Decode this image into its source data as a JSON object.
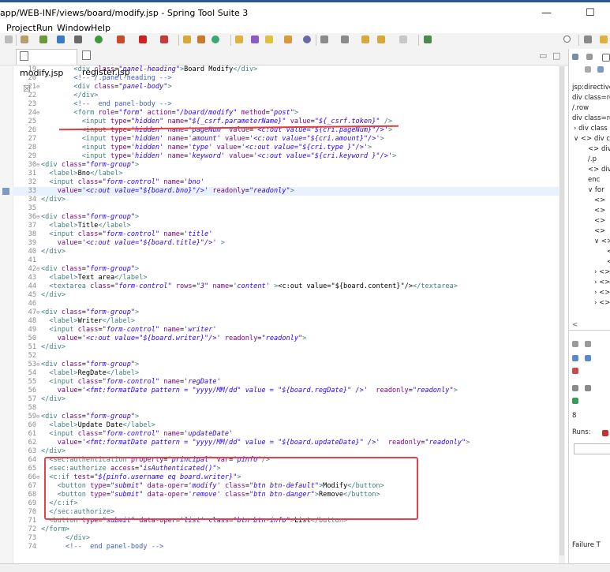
{
  "window": {
    "title": "app/WEB-INF/views/board/modify.jsp - Spring Tool Suite 3"
  },
  "menu": [
    "Project",
    "Run",
    "Window",
    "Help"
  ],
  "tabs": [
    {
      "label": "modify.jsp",
      "close": "☒",
      "active": true
    },
    {
      "label": "register.jsp",
      "active": false
    }
  ],
  "lines": [
    {
      "n": "19",
      "fold": "",
      "html": "        <span class=\"tag\">&lt;div</span> <span class=\"an\">class</span>=<span class=\"av\">\"panel-heading\"</span><span class=\"tag\">&gt;</span>Board Modify<span class=\"tag\">&lt;/div&gt;</span>"
    },
    {
      "n": "20",
      "fold": "",
      "html": "        <span class=\"cm\">&lt;!-- /.panel-heading --&gt;</span>"
    },
    {
      "n": "21",
      "fold": "⊖",
      "html": "        <span class=\"tag\">&lt;div</span> <span class=\"an\">class</span>=<span class=\"av\">\"panel-body\"</span><span class=\"tag\">&gt;</span>"
    },
    {
      "n": "22",
      "fold": "",
      "html": "        <span class=\"tag\">&lt;/div&gt;</span>"
    },
    {
      "n": "23",
      "fold": "",
      "html": "        <span class=\"cm\">&lt;!--  end panel-body --&gt;</span>"
    },
    {
      "n": "24",
      "fold": "⊖",
      "html": "        <span class=\"tag\">&lt;form</span> <span class=\"an\">role</span>=<span class=\"av\">\"form\"</span> <span class=\"an\">action</span>=<span class=\"av\">\"/board/modify\"</span> <span class=\"an\">method</span>=<span class=\"av\">\"post\"</span><span class=\"tag\">&gt;</span>"
    },
    {
      "n": "25",
      "fold": "",
      "html": "          <span class=\"tag\">&lt;input</span> <span class=\"an\">type</span>=<span class=\"av\">\"hidden\"</span> <span class=\"an\">name</span>=<span class=\"av\">\"${_csrf.parameterName}\"</span> <span class=\"an\">value</span>=<span class=\"av\">\"${_csrf.token}\"</span> <span class=\"tag\">/&gt;</span>"
    },
    {
      "n": "26",
      "fold": "",
      "html": "          <span class=\"tag\">&lt;input</span> <span class=\"an\">type</span>=<span class=\"av\">'hidden'</span> <span class=\"an\">name</span>=<span class=\"av\">'pageNum'</span> <span class=\"an\">value</span>=<span class=\"av\">'&lt;c:out value=\"${cri.pageNum}\"/&gt;'</span><span class=\"tag\">&gt;</span>"
    },
    {
      "n": "27",
      "fold": "",
      "html": "          <span class=\"tag\">&lt;input</span> <span class=\"an\">type</span>=<span class=\"av\">'hidden'</span> <span class=\"an\">name</span>=<span class=\"av\">'amount'</span> <span class=\"an\">value</span>=<span class=\"av\">'&lt;c:out value=\"${cri.amount}\"/&gt;'</span><span class=\"tag\">&gt;</span>"
    },
    {
      "n": "28",
      "fold": "",
      "html": "          <span class=\"tag\">&lt;input</span> <span class=\"an\">type</span>=<span class=\"av\">'hidden'</span> <span class=\"an\">name</span>=<span class=\"av\">'type'</span> <span class=\"an\">value</span>=<span class=\"av\">'&lt;c:out value=\"${cri.type }\"/&gt;'</span><span class=\"tag\">&gt;</span>"
    },
    {
      "n": "29",
      "fold": "",
      "html": "          <span class=\"tag\">&lt;input</span> <span class=\"an\">type</span>=<span class=\"av\">'hidden'</span> <span class=\"an\">name</span>=<span class=\"av\">'keyword'</span> <span class=\"an\">value</span>=<span class=\"av\">'&lt;c:out value=\"${cri.keyword }\"/&gt;'</span><span class=\"tag\">&gt;</span>"
    },
    {
      "n": "30",
      "fold": "⊖",
      "html": "<span class=\"tag\">&lt;div</span> <span class=\"an\">class</span>=<span class=\"av\">\"form-group\"</span><span class=\"tag\">&gt;</span>"
    },
    {
      "n": "31",
      "fold": "",
      "html": "  <span class=\"tag\">&lt;label&gt;</span>Bno<span class=\"tag\">&lt;/label&gt;</span>"
    },
    {
      "n": "32",
      "fold": "",
      "html": "  <span class=\"tag\">&lt;input</span> <span class=\"an\">class</span>=<span class=\"av\">\"form-control\"</span> <span class=\"an\">name</span>=<span class=\"av\">'bno'</span>"
    },
    {
      "n": "33",
      "fold": "",
      "cur": true,
      "html": "    <span class=\"an\">value</span>=<span class=\"av\">'&lt;c:out value=\"${board.bno}\"/&gt;'</span> <span class=\"an\">readonly</span>=<span class=\"av\">\"readonly\"</span><span class=\"tag\">&gt;</span>"
    },
    {
      "n": "34",
      "fold": "",
      "html": "<span class=\"tag\">&lt;/div&gt;</span>"
    },
    {
      "n": "35",
      "fold": "",
      "html": ""
    },
    {
      "n": "36",
      "fold": "⊖",
      "html": "<span class=\"tag\">&lt;div</span> <span class=\"an\">class</span>=<span class=\"av\">\"form-group\"</span><span class=\"tag\">&gt;</span>"
    },
    {
      "n": "37",
      "fold": "",
      "html": "  <span class=\"tag\">&lt;label&gt;</span>Title<span class=\"tag\">&lt;/label&gt;</span>"
    },
    {
      "n": "38",
      "fold": "",
      "html": "  <span class=\"tag\">&lt;input</span> <span class=\"an\">class</span>=<span class=\"av\">\"form-control\"</span> <span class=\"an\">name</span>=<span class=\"av\">'title'</span>"
    },
    {
      "n": "39",
      "fold": "",
      "html": "    <span class=\"an\">value</span>=<span class=\"av\">'&lt;c:out value=\"${board.title}\"/&gt;'</span> <span class=\"tag\">&gt;</span>"
    },
    {
      "n": "40",
      "fold": "",
      "html": "<span class=\"tag\">&lt;/div&gt;</span>"
    },
    {
      "n": "41",
      "fold": "",
      "html": ""
    },
    {
      "n": "42",
      "fold": "⊖",
      "html": "<span class=\"tag\">&lt;div</span> <span class=\"an\">class</span>=<span class=\"av\">\"form-group\"</span><span class=\"tag\">&gt;</span>"
    },
    {
      "n": "43",
      "fold": "",
      "html": "  <span class=\"tag\">&lt;label&gt;</span>Text area<span class=\"tag\">&lt;/label&gt;</span>"
    },
    {
      "n": "44",
      "fold": "",
      "html": "  <span class=\"tag\">&lt;textarea</span> <span class=\"an\">class</span>=<span class=\"av\">\"form-control\"</span> <span class=\"an\">rows</span>=<span class=\"av\">\"3\"</span> <span class=\"an\">name</span>=<span class=\"av\">'content'</span> <span class=\"tag\">&gt;</span>&lt;c:out value=\"${board.content}\"/&gt;<span class=\"tag\">&lt;/textarea&gt;</span>"
    },
    {
      "n": "45",
      "fold": "",
      "html": "<span class=\"tag\">&lt;/div&gt;</span>"
    },
    {
      "n": "46",
      "fold": "",
      "html": ""
    },
    {
      "n": "47",
      "fold": "⊖",
      "html": "<span class=\"tag\">&lt;div</span> <span class=\"an\">class</span>=<span class=\"av\">\"form-group\"</span><span class=\"tag\">&gt;</span>"
    },
    {
      "n": "48",
      "fold": "",
      "html": "  <span class=\"tag\">&lt;label&gt;</span>Writer<span class=\"tag\">&lt;/label&gt;</span>"
    },
    {
      "n": "49",
      "fold": "",
      "html": "  <span class=\"tag\">&lt;input</span> <span class=\"an\">class</span>=<span class=\"av\">\"form-control\"</span> <span class=\"an\">name</span>=<span class=\"av\">'writer'</span>"
    },
    {
      "n": "50",
      "fold": "",
      "html": "    <span class=\"an\">value</span>=<span class=\"av\">'&lt;c:out value=\"${board.writer}\"/&gt;'</span> <span class=\"an\">readonly</span>=<span class=\"av\">\"readonly\"</span><span class=\"tag\">&gt;</span>"
    },
    {
      "n": "51",
      "fold": "",
      "html": "<span class=\"tag\">&lt;/div&gt;</span>"
    },
    {
      "n": "52",
      "fold": "",
      "html": ""
    },
    {
      "n": "53",
      "fold": "⊖",
      "html": "<span class=\"tag\">&lt;div</span> <span class=\"an\">class</span>=<span class=\"av\">\"form-group\"</span><span class=\"tag\">&gt;</span>"
    },
    {
      "n": "54",
      "fold": "",
      "html": "  <span class=\"tag\">&lt;label&gt;</span>RegDate<span class=\"tag\">&lt;/label&gt;</span>"
    },
    {
      "n": "55",
      "fold": "",
      "html": "  <span class=\"tag\">&lt;input</span> <span class=\"an\">class</span>=<span class=\"av\">\"form-control\"</span> <span class=\"an\">name</span>=<span class=\"av\">'regDate'</span>"
    },
    {
      "n": "56",
      "fold": "",
      "html": "    <span class=\"an\">value</span>=<span class=\"av\">'&lt;fmt:formatDate pattern = \"yyyy/MM/dd\" value = \"${board.regDate}\" /&gt;'</span>  <span class=\"an\">readonly</span>=<span class=\"av\">\"readonly\"</span><span class=\"tag\">&gt;</span>"
    },
    {
      "n": "57",
      "fold": "",
      "html": "<span class=\"tag\">&lt;/div&gt;</span>"
    },
    {
      "n": "58",
      "fold": "",
      "html": ""
    },
    {
      "n": "59",
      "fold": "⊖",
      "html": "<span class=\"tag\">&lt;div</span> <span class=\"an\">class</span>=<span class=\"av\">\"form-group\"</span><span class=\"tag\">&gt;</span>"
    },
    {
      "n": "60",
      "fold": "",
      "html": "  <span class=\"tag\">&lt;label&gt;</span>Update Date<span class=\"tag\">&lt;/label&gt;</span>"
    },
    {
      "n": "61",
      "fold": "",
      "html": "  <span class=\"tag\">&lt;input</span> <span class=\"an\">class</span>=<span class=\"av\">\"form-control\"</span> <span class=\"an\">name</span>=<span class=\"av\">'updateDate'</span>"
    },
    {
      "n": "62",
      "fold": "",
      "html": "    <span class=\"an\">value</span>=<span class=\"av\">'&lt;fmt:formatDate pattern = \"yyyy/MM/dd\" value = \"${board.updateDate}\" /&gt;'</span>  <span class=\"an\">readonly</span>=<span class=\"av\">\"readonly\"</span><span class=\"tag\">&gt;</span>"
    },
    {
      "n": "63",
      "fold": "",
      "html": "<span class=\"tag\">&lt;/div&gt;</span>"
    },
    {
      "n": "64",
      "fold": "",
      "html": "  <span class=\"tag\">&lt;sec:authentication</span> <span class=\"an\">property</span>=<span class=\"av\">\"principal\"</span> <span class=\"an\">var</span>=<span class=\"av\">\"pinfo\"</span><span class=\"tag\">/&gt;</span>"
    },
    {
      "n": "65",
      "fold": "",
      "html": "  <span class=\"tag\">&lt;sec:authorize</span> <span class=\"an\">access</span>=<span class=\"av\">\"isAuthenticated()\"</span><span class=\"tag\">&gt;</span>"
    },
    {
      "n": "66",
      "fold": "⊖",
      "html": "  <span class=\"tag\">&lt;c:if</span> <span class=\"an\">test</span>=<span class=\"av\">\"${pinfo.username eq board.writer}\"</span><span class=\"tag\">&gt;</span>"
    },
    {
      "n": "67",
      "fold": "",
      "html": "    <span class=\"tag\">&lt;button</span> <span class=\"an\">type</span>=<span class=\"av\">\"submit\"</span> <span class=\"an\">data-oper</span>=<span class=\"av\">'modify'</span> <span class=\"an\">class</span>=<span class=\"av\">\"btn btn-default\"</span><span class=\"tag\">&gt;</span>Modify<span class=\"tag\">&lt;/button&gt;</span>"
    },
    {
      "n": "68",
      "fold": "",
      "html": "    <span class=\"tag\">&lt;button</span> <span class=\"an\">type</span>=<span class=\"av\">\"submit\"</span> <span class=\"an\">data-oper</span>=<span class=\"av\">'remove'</span> <span class=\"an\">class</span>=<span class=\"av\">\"btn btn-danger\"</span><span class=\"tag\">&gt;</span>Remove<span class=\"tag\">&lt;/button&gt;</span>"
    },
    {
      "n": "69",
      "fold": "",
      "html": "  <span class=\"tag\">&lt;/c:if&gt;</span>"
    },
    {
      "n": "70",
      "fold": "",
      "html": "  <span class=\"tag\">&lt;/sec:authorize&gt;</span>"
    },
    {
      "n": "71",
      "fold": "",
      "html": "  <span class=\"tag\">&lt;button</span> <span class=\"an\">type</span>=<span class=\"av\">\"submit\"</span> <span class=\"an\">data-oper</span>=<span class=\"av\">'list'</span> <span class=\"an\">class</span>=<span class=\"av\">\"btn btn-info\"</span><span class=\"tag\">&gt;</span>List<span class=\"tag\">&lt;/button&gt;</span>"
    },
    {
      "n": "72",
      "fold": "",
      "html": "<span class=\"tag\">&lt;/form&gt;</span>"
    },
    {
      "n": "73",
      "fold": "",
      "html": "      <span class=\"tag\">&lt;/div&gt;</span>"
    },
    {
      "n": "74",
      "fold": "",
      "html": "      <span class=\"cm\">&lt;!--  end panel-body --&gt;</span>"
    }
  ],
  "outline": [
    "jsp:directive",
    "div class=ro",
    "/.row",
    "div class=ro",
    "› div class",
    "∨ <> div cla",
    "<> div",
    "/.p",
    "<> div",
    "enc",
    "∨ for",
    "<>",
    "<>",
    "<>",
    "<>",
    "∨ <>",
    "<",
    "<",
    "› <>",
    "› <>",
    "› <>",
    "› <>"
  ],
  "right_lower": {
    "runs_label": "Runs:",
    "failure_label": "Failure T"
  },
  "colors": {
    "annotation": "#e8404a",
    "tag": "#3f7f7f",
    "attr_name": "#7f007f",
    "attr_value": "#2a00ff",
    "comment": "#3f5fbf"
  }
}
